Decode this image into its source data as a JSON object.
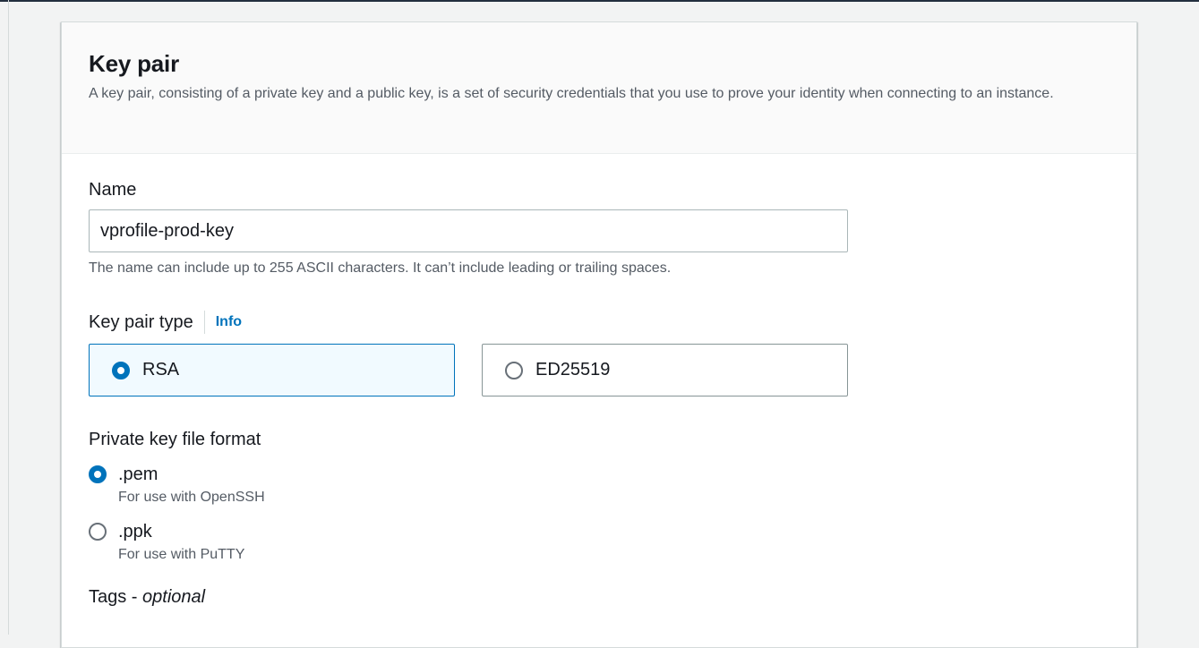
{
  "section": {
    "title": "Key pair",
    "description": "A key pair, consisting of a private key and a public key, is a set of security credentials that you use to prove your identity when connecting to an instance."
  },
  "name_field": {
    "label": "Name",
    "value": "vprofile-prod-key",
    "constraint": "The name can include up to 255 ASCII characters. It can’t include leading or trailing spaces."
  },
  "key_pair_type": {
    "label": "Key pair type",
    "info_link": "Info",
    "options": [
      {
        "label": "RSA",
        "selected": true
      },
      {
        "label": "ED25519",
        "selected": false
      }
    ]
  },
  "private_key_format": {
    "label": "Private key file format",
    "options": [
      {
        "name": ".pem",
        "description": "For use with OpenSSH",
        "selected": true
      },
      {
        "name": ".ppk",
        "description": "For use with PuTTY",
        "selected": false
      }
    ]
  },
  "tags": {
    "label": "Tags - ",
    "optional": "optional"
  },
  "colors": {
    "accent": "#0073bb",
    "selected_tile_bg": "#f1faff",
    "header_bg": "#fafafa"
  }
}
